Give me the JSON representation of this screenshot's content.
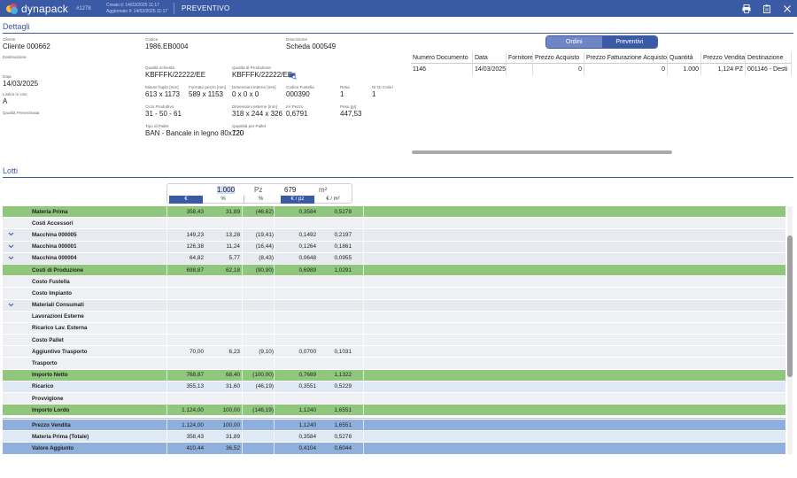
{
  "header": {
    "app_name": "dynapack",
    "doc_number": "#1278",
    "created": "Creato il: 14/03/2025 11:17",
    "updated": "Aggiornato il: 14/03/2025 11:17",
    "doc_type": "PREVENTIVO",
    "icons": [
      "print-icon",
      "clipboard-icon",
      "close-icon"
    ]
  },
  "dettagli": {
    "title": "Dettagli",
    "cliente": {
      "label": "Cliente",
      "value": "Cliente 000662"
    },
    "destinazione": {
      "label": "Destinazione",
      "value": ""
    },
    "data": {
      "label": "Data",
      "value": "14/03/2025"
    },
    "listino": {
      "label": "Listino in Uso",
      "value": "A"
    },
    "qualita_prev": {
      "label": "Qualità Preventivata",
      "value": ""
    },
    "codice": {
      "label": "Codice",
      "value": "1986.EB0004"
    },
    "descrizione": {
      "label": "Descrizione",
      "value": "Scheda 000549"
    },
    "qualita_richiesta": {
      "label": "Qualità richiesta",
      "value": "KBFFFK/22222/EE"
    },
    "qualita_produzione": {
      "label": "Qualità di Produzione",
      "value": "KBFFFK/22222/EE"
    },
    "misure_foglio": {
      "label": "Misure foglio [mm]",
      "value": "613 x 1173"
    },
    "formato_pezzo": {
      "label": "Formato pezzo [mm]",
      "value": "589 x 1153"
    },
    "dim_interne": {
      "label": "Dimensioni interne [mm]",
      "value": "0 x 0 x 0"
    },
    "codice_fustella": {
      "label": "Codice Fustella",
      "value": "000390"
    },
    "resa": {
      "label": "Resa",
      "value": "1"
    },
    "nr_colori": {
      "label": "Nr Di Colori",
      "value": "1"
    },
    "ciclo_produttivo": {
      "label": "Ciclo Produttivo",
      "value": "31 - 50 - 61"
    },
    "dim_esterne": {
      "label": "Dimensioni esterne [mm]",
      "value": "318 x 244 x 326"
    },
    "m2_pezzo": {
      "label": "m² Pezzo",
      "value": "0,6791"
    },
    "peso": {
      "label": "Peso [gr]",
      "value": "447,53"
    },
    "tipo_pallet": {
      "label": "Tipo di Pallet",
      "value": "BAN - Bancale in legno 80x120"
    },
    "quantita_pallet": {
      "label": "Quantità per Pallet",
      "value": "720"
    }
  },
  "toggle": {
    "left": "Ordini",
    "right": "Preventivi"
  },
  "right_table": {
    "columns": [
      "Numero Documento",
      "Data",
      "Fornitore",
      "Prezzo Acquisto",
      "Prezzo Fatturazione Acquisto",
      "Quantità",
      "Prezzo Vendita",
      "Destinazione"
    ],
    "rows": [
      [
        "1146",
        "14/03/2025",
        "",
        "0",
        "0",
        "1.000",
        "1,124 PZ",
        "001146 - Desti"
      ]
    ]
  },
  "lotti": {
    "title": "Lotti",
    "quantity": "1.000",
    "quantity_unit": "Pz",
    "area": "679",
    "area_unit": "m²",
    "chips": [
      "€",
      "%",
      "%",
      "€ / pz",
      "€ / m²"
    ]
  },
  "grid_rows": [
    {
      "name": "Materia Prima",
      "style": "green",
      "chev": false,
      "v": [
        "358,43",
        "31,89",
        "(46,62)",
        "0,3584",
        "0,5278"
      ]
    },
    {
      "name": "Costi Accessori",
      "style": "white",
      "chev": false,
      "v": [
        "",
        "",
        "",
        "",
        ""
      ]
    },
    {
      "name": "Macchina 000005",
      "style": "grey",
      "chev": true,
      "v": [
        "149,23",
        "13,28",
        "(19,41)",
        "0,1492",
        "0,2197"
      ]
    },
    {
      "name": "Macchina 000001",
      "style": "grey",
      "chev": true,
      "v": [
        "126,38",
        "11,24",
        "(16,44)",
        "0,1264",
        "0,1861"
      ]
    },
    {
      "name": "Macchina 000004",
      "style": "grey",
      "chev": true,
      "v": [
        "64,82",
        "5,77",
        "(8,43)",
        "0,0648",
        "0,0955"
      ]
    },
    {
      "name": "Costi di Produzione",
      "style": "green",
      "chev": false,
      "v": [
        "698,87",
        "62,18",
        "(90,90)",
        "0,6989",
        "1,0291"
      ]
    },
    {
      "name": "Costo Fustella",
      "style": "white",
      "chev": false,
      "v": [
        "",
        "",
        "",
        "",
        ""
      ]
    },
    {
      "name": "Costo Impianto",
      "style": "white",
      "chev": false,
      "v": [
        "",
        "",
        "",
        "",
        ""
      ]
    },
    {
      "name": "Materiali Consumati",
      "style": "grey",
      "chev": true,
      "v": [
        "",
        "",
        "",
        "",
        ""
      ]
    },
    {
      "name": "Lavorazioni Esterne",
      "style": "white",
      "chev": false,
      "v": [
        "",
        "",
        "",
        "",
        ""
      ]
    },
    {
      "name": "Ricarico Lav. Esterna",
      "style": "white",
      "chev": false,
      "v": [
        "",
        "",
        "",
        "",
        ""
      ]
    },
    {
      "name": "Costo Pallet",
      "style": "white",
      "chev": false,
      "v": [
        "",
        "",
        "",
        "",
        ""
      ]
    },
    {
      "name": "Aggiuntivo Trasporto",
      "style": "white",
      "chev": false,
      "v": [
        "70,00",
        "6,23",
        "(9,10)",
        "0,0700",
        "0,1031"
      ]
    },
    {
      "name": "Trasporto",
      "style": "white",
      "chev": false,
      "v": [
        "",
        "",
        "",
        "",
        ""
      ]
    },
    {
      "name": "Importo Netto",
      "style": "green",
      "chev": false,
      "v": [
        "768,87",
        "68,40",
        "(100,00)",
        "0,7689",
        "1,1322"
      ]
    },
    {
      "name": "Ricarico",
      "style": "light",
      "chev": false,
      "v": [
        "355,13",
        "31,60",
        "(46,19)",
        "0,3551",
        "0,5229"
      ]
    },
    {
      "name": "Provvigione",
      "style": "white",
      "chev": false,
      "v": [
        "",
        "",
        "",
        "",
        ""
      ]
    },
    {
      "name": "Importo Lordo",
      "style": "green",
      "chev": false,
      "v": [
        "1.124,00",
        "100,00",
        "(146,19)",
        "1,1240",
        "1,6551"
      ]
    }
  ],
  "summary_rows": [
    {
      "name": "Prezzo Vendita",
      "style": "blue",
      "v": [
        "1.124,00",
        "100,00",
        "",
        "1,1240",
        "1,6551"
      ]
    },
    {
      "name": "Materia Prima (Totale)",
      "style": "light",
      "v": [
        "358,43",
        "31,89",
        "",
        "0,3584",
        "0,5278"
      ]
    },
    {
      "name": "Valore Aggiunto",
      "style": "blue",
      "v": [
        "410,44",
        "36,52",
        "",
        "0,4104",
        "0,6044"
      ]
    }
  ]
}
